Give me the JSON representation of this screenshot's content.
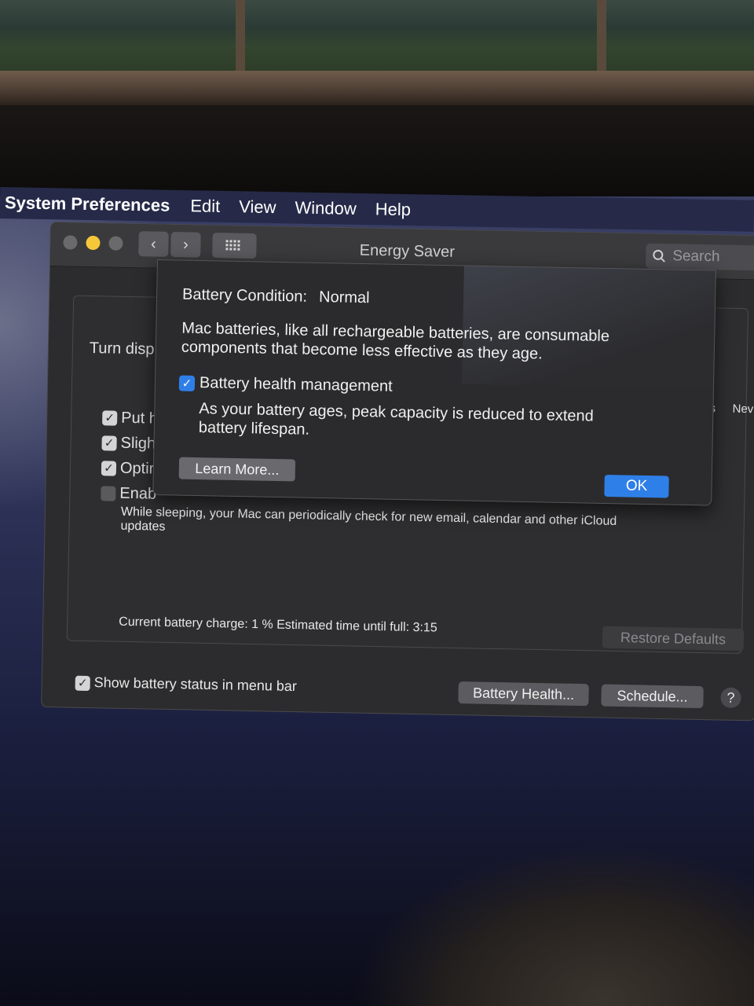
{
  "menubar": {
    "app_name": "System Preferences",
    "items": [
      "Edit",
      "View",
      "Window",
      "Help"
    ]
  },
  "window": {
    "title": "Energy Saver",
    "search_placeholder": "Search",
    "icons": [
      "close-dot",
      "minimize-dot",
      "zoom-dot",
      "chevron-left-icon",
      "chevron-right-icon",
      "grid-icon",
      "search-icon"
    ]
  },
  "panel": {
    "turn_display_label": "Turn disp",
    "options": [
      {
        "label": "Put h",
        "checked": true
      },
      {
        "label": "Sligh",
        "checked": true
      },
      {
        "label": "Optir",
        "checked": true
      },
      {
        "label": "Enab",
        "checked": false
      }
    ],
    "right_edge_labels": [
      "rs",
      "Nev"
    ],
    "powernap_description": "While sleeping, your Mac can periodically check for new email, calendar and other iCloud updates",
    "battery_status": "Current battery charge: 1 % Estimated time until full: 3:15",
    "restore_defaults_label": "Restore Defaults",
    "show_status_label": "Show battery status in menu bar",
    "show_status_checked": true,
    "battery_health_button": "Battery Health...",
    "schedule_button": "Schedule...",
    "help_label": "?"
  },
  "sheet": {
    "condition_label": "Battery Condition:",
    "condition_value": "Normal",
    "description": "Mac batteries, like all rechargeable batteries, are consumable components that become less effective as they age.",
    "bhm_label": "Battery health management",
    "bhm_checked": true,
    "bhm_description": "As your battery ages, peak capacity is reduced to extend battery lifespan.",
    "learn_more_label": "Learn More...",
    "ok_label": "OK"
  },
  "colors": {
    "accent": "#2f7fe8",
    "window_bg": "#2c2c2e",
    "traffic_yellow": "#f5c83a"
  }
}
